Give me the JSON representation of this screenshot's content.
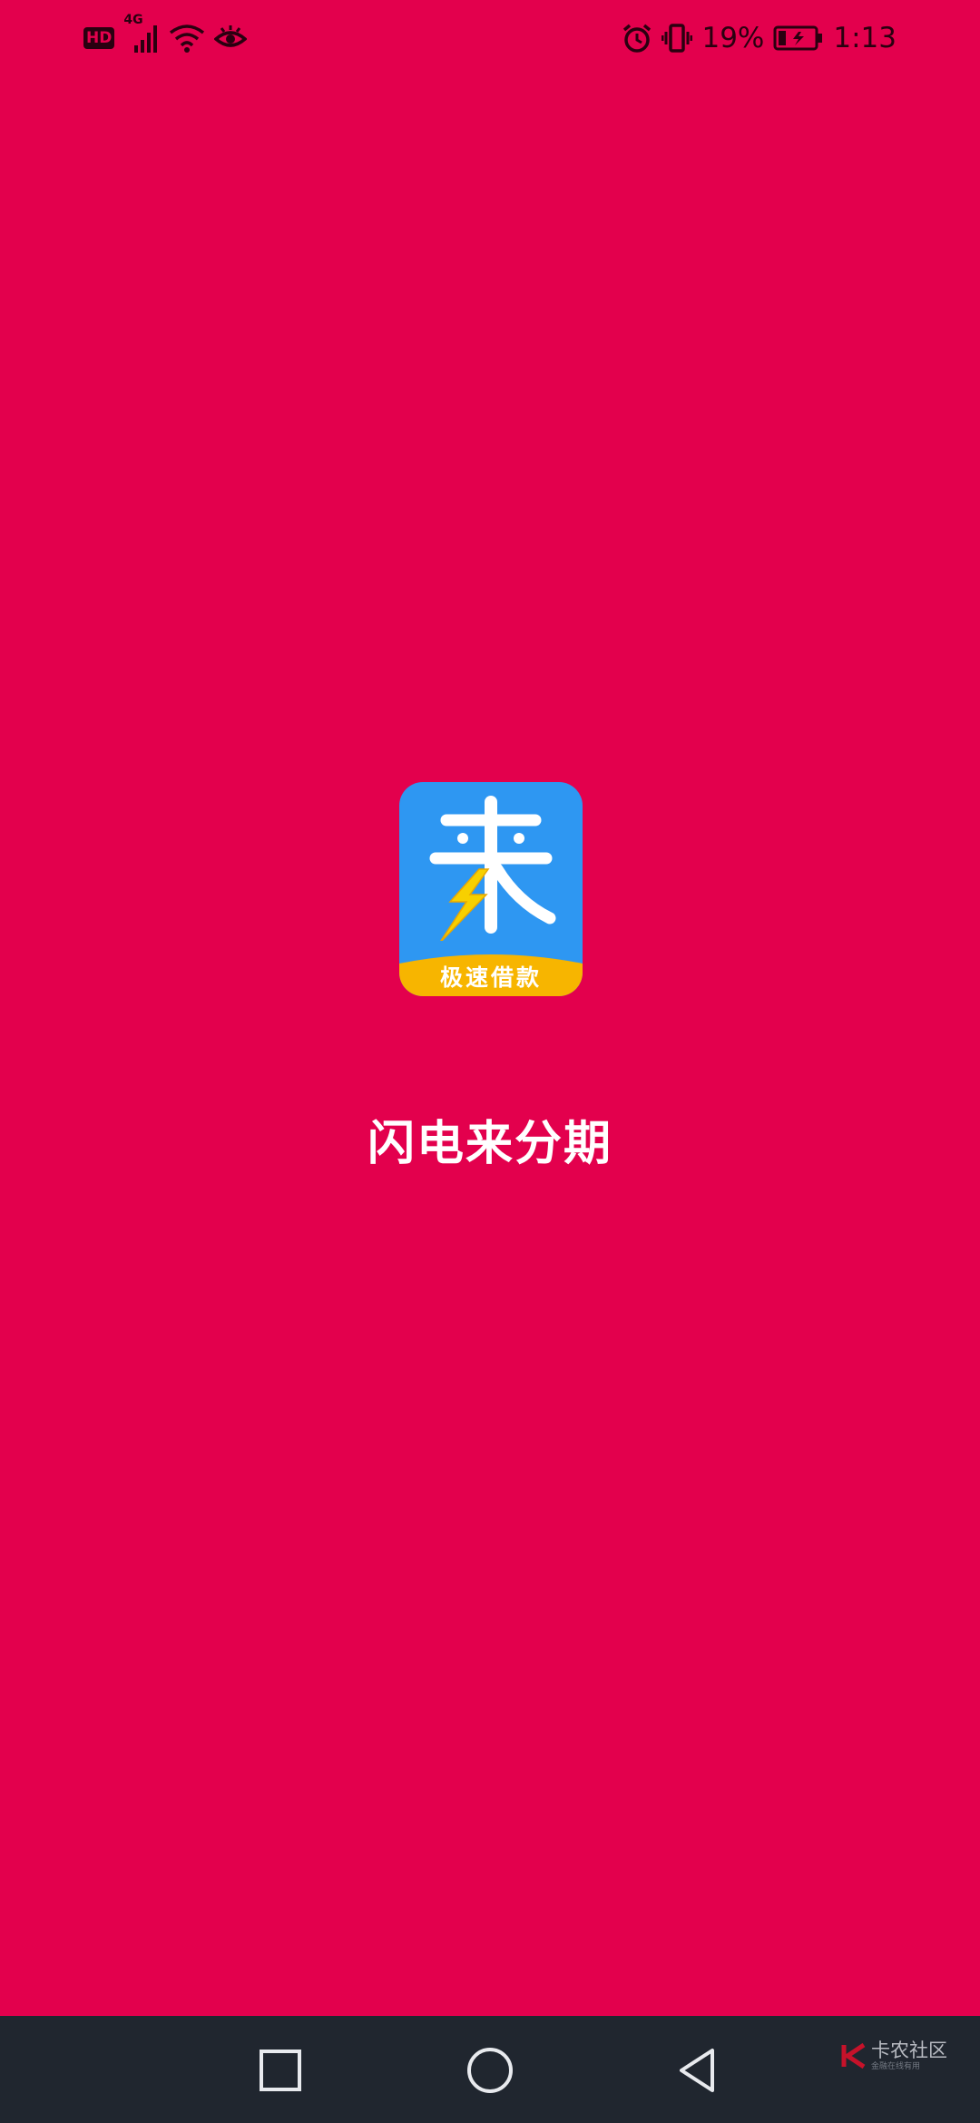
{
  "status_bar": {
    "hd_label": "HD",
    "network_label": "4G",
    "battery_percent": "19%",
    "time": "1:13",
    "icons": [
      "hd-icon",
      "signal-icon",
      "wifi-icon",
      "eye-icon",
      "alarm-icon",
      "vibrate-icon",
      "battery-icon"
    ]
  },
  "splash": {
    "logo_char": "来",
    "logo_banner": "极速借款",
    "app_name": "闪电来分期",
    "colors": {
      "background": "#e3004d",
      "logo_blue": "#2e97f2",
      "logo_banner": "#f7b500",
      "lightning": "#f7d000"
    }
  },
  "nav_bar": {
    "buttons": [
      "recent-apps-icon",
      "home-icon",
      "back-icon"
    ]
  },
  "watermark": {
    "main": "卡农社区",
    "sub": "金融在线有用"
  }
}
